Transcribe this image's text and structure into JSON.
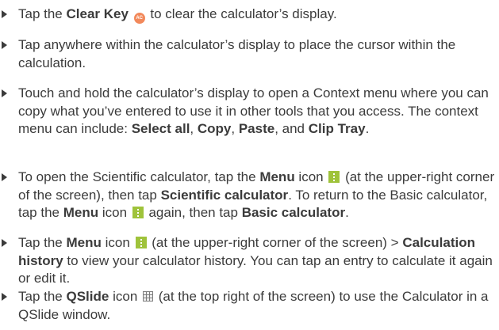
{
  "bullets": [
    {
      "pre": "Tap the ",
      "clear_key": "Clear Key",
      "clear_icon_glyph": "AC",
      "post": " to clear the calculator’s display."
    },
    {
      "text": "Tap anywhere within the calculator’s display to place the cursor within the calculation."
    },
    {
      "text": "Touch and hold the calculator’s display to open a Context menu where you can copy what you’ve entered to use it in other tools that you access. The context menu can include: ",
      "select_all": "Select all",
      "sep1": ", ",
      "copy": "Copy",
      "sep2": ", ",
      "paste": "Paste",
      "sep3": ", and ",
      "clip_tray": "Clip Tray",
      "end": "."
    },
    {
      "t1": "To open the Scientific calculator, tap the ",
      "menu1": "Menu",
      "t2": " icon ",
      "t3": " (at the upper-right corner of the screen), then tap ",
      "scientific": "Scientific calculator",
      "t4": ". To return to the Basic calculator, tap the ",
      "menu2": "Menu",
      "t5": " icon ",
      "t6": " again, then tap ",
      "basic": "Basic calculator",
      "t7": "."
    },
    {
      "t1": "Tap the ",
      "menu": "Menu",
      "t2": " icon ",
      "t3": " (at the upper-right corner of the screen) > ",
      "history": "Calculation history",
      "t4": " to view your calculator history. You can tap an entry to calculate it again or edit it."
    },
    {
      "t1": "Tap the ",
      "qslide": "QSlide",
      "t2": " icon ",
      "t3": " (at the top right of the screen) to use the Calculator in a QSlide window."
    }
  ],
  "icons": {
    "clear_key": "clear-key-icon",
    "menu": "menu-icon",
    "qslide": "qslide-icon"
  },
  "colors": {
    "text": "#3b3b3b",
    "clear_key_icon": "#f2895b",
    "menu_icon": "#9fc33b",
    "qslide_icon": "#7d7d7d"
  }
}
